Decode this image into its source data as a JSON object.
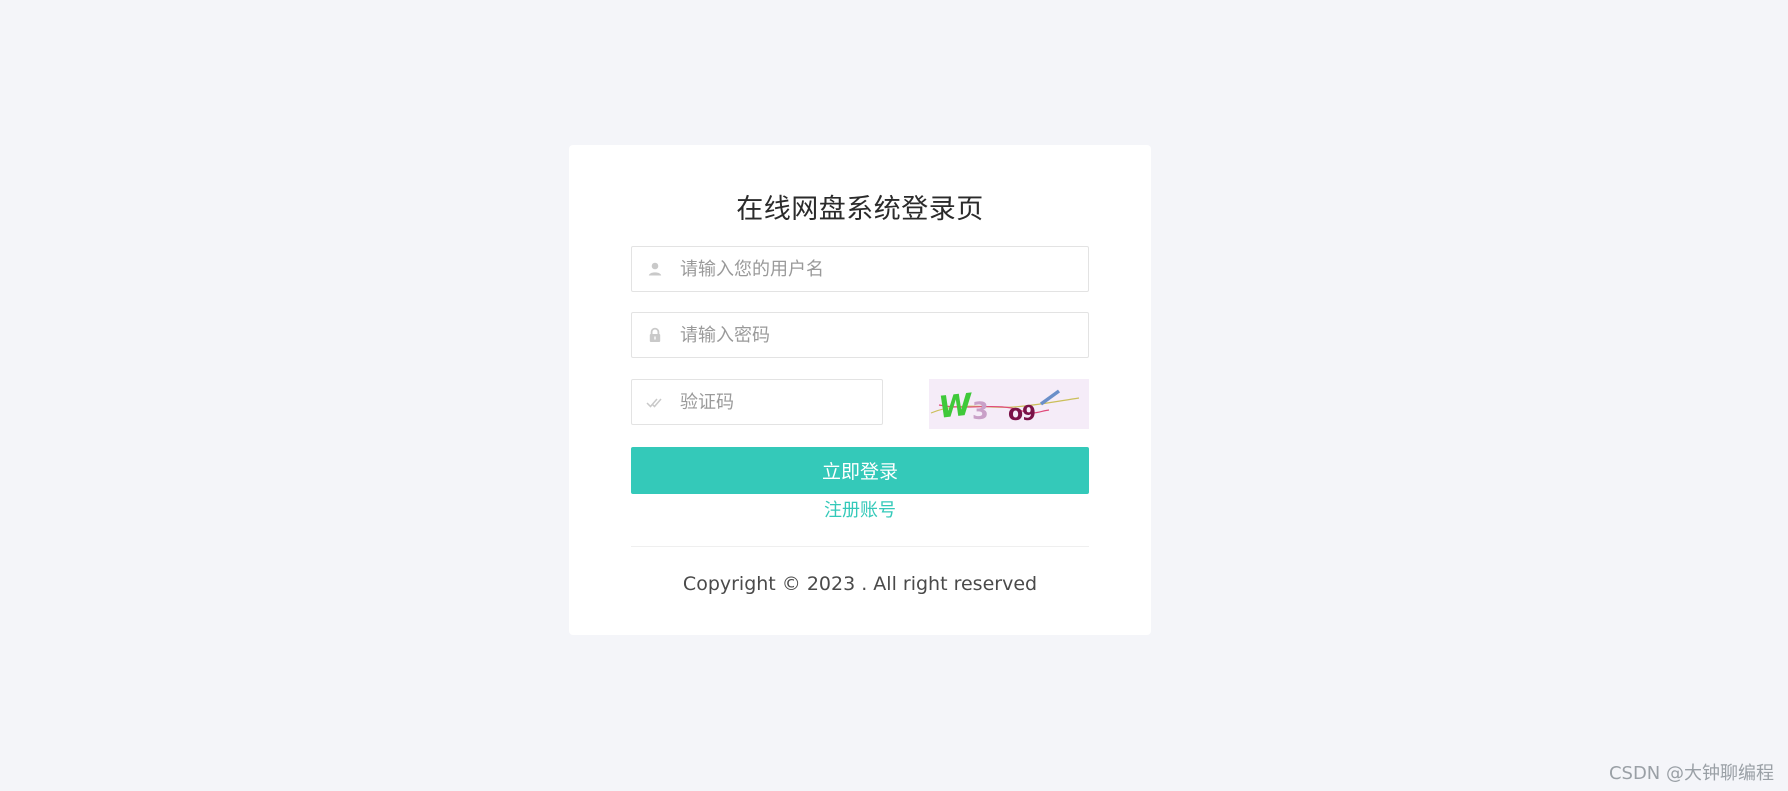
{
  "login": {
    "title": "在线网盘系统登录页",
    "username_placeholder": "请输入您的用户名",
    "password_placeholder": "请输入密码",
    "captcha_placeholder": "验证码",
    "submit_label": "立即登录",
    "register_label": "注册账号",
    "copyright": "Copyright © 2023 . All right reserved",
    "captcha_text": "W3o9",
    "icons": {
      "username": "user-icon",
      "password": "lock-icon",
      "captcha": "check-icon"
    }
  },
  "watermark": "CSDN @大钟聊编程",
  "colors": {
    "background": "#f4f5f9",
    "card": "#ffffff",
    "accent": "#34c9b9",
    "captcha_bg": "#f5ecf8"
  }
}
